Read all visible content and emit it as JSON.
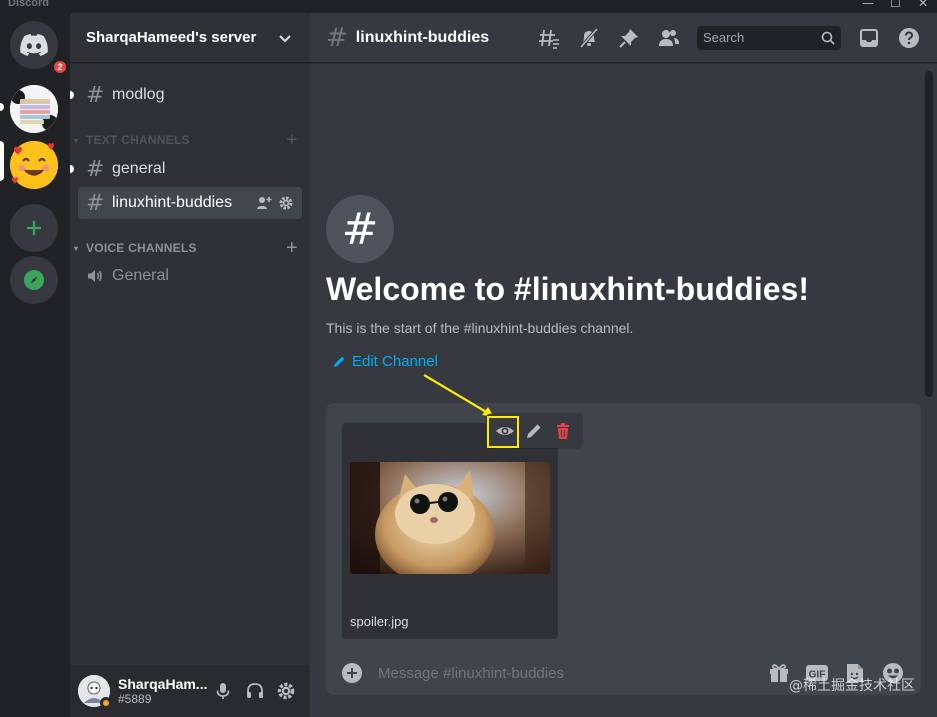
{
  "app": {
    "title": "Discord",
    "window_controls": [
      "—",
      "☐",
      "✕"
    ]
  },
  "servers": {
    "home_badge": "2"
  },
  "sidebar": {
    "server_name": "SharqaHameed's server",
    "uncategorized": [
      {
        "label": "modlog"
      }
    ],
    "text_category": "TEXT CHANNELS",
    "text_channels": [
      {
        "label": "general"
      },
      {
        "label": "linuxhint-buddies"
      }
    ],
    "voice_category": "VOICE CHANNELS",
    "voice_channels": [
      {
        "label": "General"
      }
    ]
  },
  "user": {
    "name": "SharqaHam...",
    "tag": "#5889"
  },
  "header": {
    "channel_name": "linuxhint-buddies",
    "search_placeholder": "Search"
  },
  "welcome": {
    "title": "Welcome to #linuxhint-buddies!",
    "subtitle": "This is the start of the #linuxhint-buddies channel.",
    "edit_label": "Edit Channel"
  },
  "attachment": {
    "filename": "spoiler.jpg"
  },
  "composer": {
    "placeholder": "Message #linuxhint-buddies"
  },
  "watermark": "@稀土掘金技术社区",
  "colors": {
    "accent": "#5865f2",
    "link": "#00aff4",
    "danger": "#ed4245",
    "highlight": "#ffea00",
    "online_idle": "#faa81a"
  }
}
